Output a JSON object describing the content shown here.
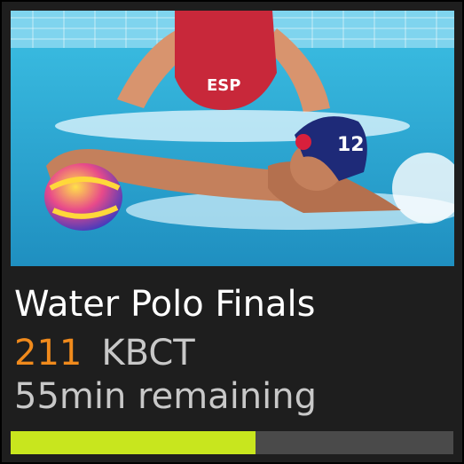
{
  "program": {
    "title": "Water Polo Finals",
    "channel_number": "211",
    "channel_name": "KBCT",
    "time_remaining": "55min remaining",
    "progress_fraction": 0.553
  },
  "thumbnail": {
    "cap_text": "ESP",
    "cap_number": "12"
  },
  "colors": {
    "tile_background": "#1e1e1e",
    "channel_number": "#f08a1c",
    "secondary_text": "#c8c8c8",
    "progress_fill": "#c8e61e",
    "progress_track": "#4a4a4a",
    "water": "#2fb0d8"
  }
}
